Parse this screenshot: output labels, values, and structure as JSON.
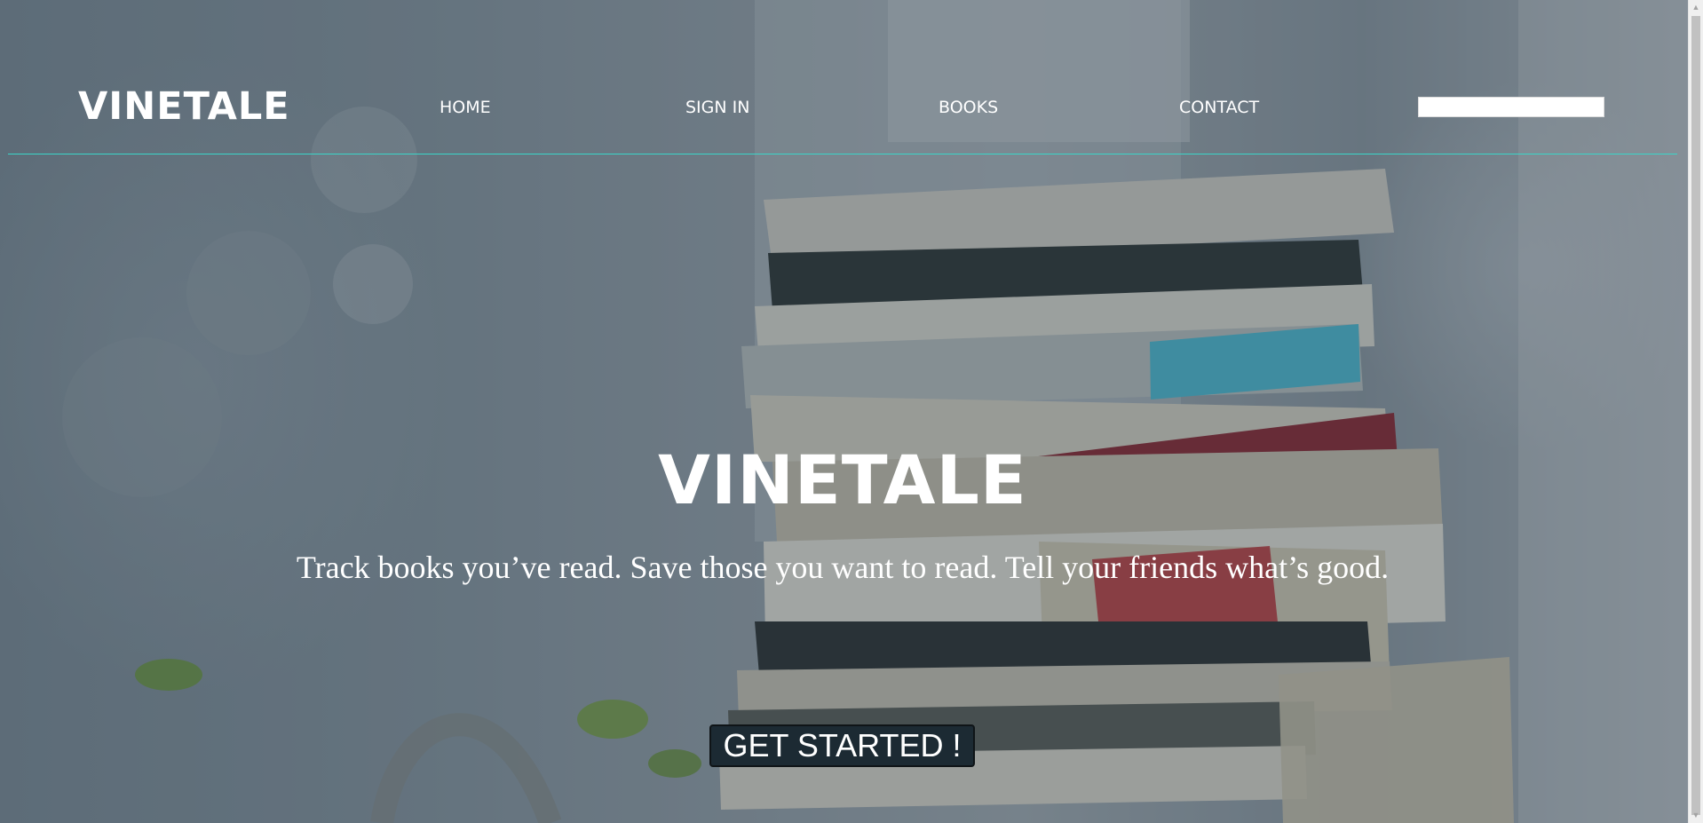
{
  "navbar": {
    "brand": "VINETALE",
    "items": [
      {
        "label": "HOME"
      },
      {
        "label": "SIGN IN"
      },
      {
        "label": "BOOKS"
      },
      {
        "label": "CONTACT"
      }
    ],
    "search": {
      "value": "",
      "placeholder": ""
    },
    "underline_color": "#3ad6c9"
  },
  "hero": {
    "title": "VINETALE",
    "subtitle": "Track books you’ve read. Save those you want to read. Tell your friends what’s good.",
    "cta_label": "GET STARTED !"
  },
  "background": {
    "image": "stack-of-books-photo",
    "overlay_color": "#28374a"
  },
  "scrollbar": {
    "up_icon": "triangle-up-icon",
    "down_icon": "triangle-down-icon"
  }
}
